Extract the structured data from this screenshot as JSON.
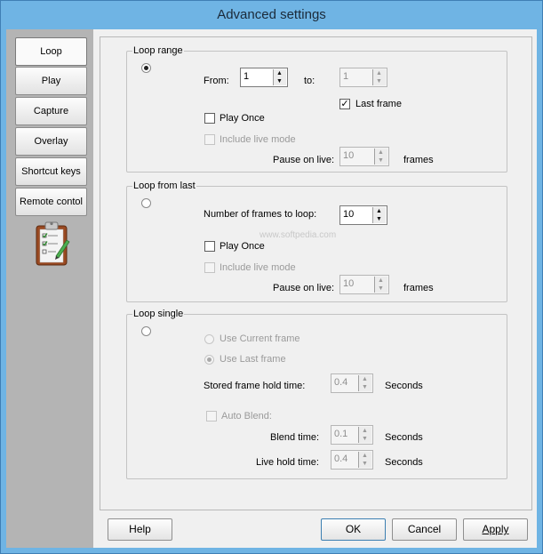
{
  "window": {
    "title": "Advanced settings"
  },
  "sidebar": {
    "items": [
      {
        "label": "Loop",
        "active": true
      },
      {
        "label": "Play"
      },
      {
        "label": "Capture"
      },
      {
        "label": "Overlay"
      },
      {
        "label": "Shortcut keys"
      },
      {
        "label": "Remote contol"
      }
    ],
    "icon": "clipboard-checklist-icon"
  },
  "loop_range": {
    "title": "Loop range",
    "selected": true,
    "from_label": "From:",
    "from_value": "1",
    "to_label": "to:",
    "to_value": "1",
    "last_frame_label": "Last frame",
    "last_frame_checked": true,
    "play_once_label": "Play Once",
    "play_once_checked": false,
    "include_live_label": "Include live mode",
    "pause_label": "Pause on live:",
    "pause_value": "10",
    "frames_label": "frames"
  },
  "loop_from_last": {
    "title": "Loop from last",
    "selected": false,
    "frames_to_loop_label": "Number of frames to loop:",
    "frames_to_loop_value": "10",
    "play_once_label": "Play Once",
    "play_once_checked": false,
    "include_live_label": "Include live mode",
    "pause_label": "Pause on live:",
    "pause_value": "10",
    "frames_label": "frames"
  },
  "loop_single": {
    "title": "Loop single",
    "selected": false,
    "use_current_label": "Use Current frame",
    "use_last_label": "Use Last frame",
    "use_last_selected": true,
    "hold_time_label": "Stored frame hold time:",
    "hold_time_value": "0.4",
    "seconds_label": "Seconds",
    "auto_blend_label": "Auto Blend:",
    "blend_time_label": "Blend time:",
    "blend_time_value": "0.1",
    "live_hold_label": "Live hold time:",
    "live_hold_value": "0.4"
  },
  "buttons": {
    "help": "Help",
    "ok": "OK",
    "cancel": "Cancel",
    "apply": "Apply"
  },
  "watermark": "www.softpedia.com",
  "colors": {
    "titlebar": "#6fb4e4",
    "sidebar": "#b4b4b4",
    "client": "#f0f0f0"
  }
}
